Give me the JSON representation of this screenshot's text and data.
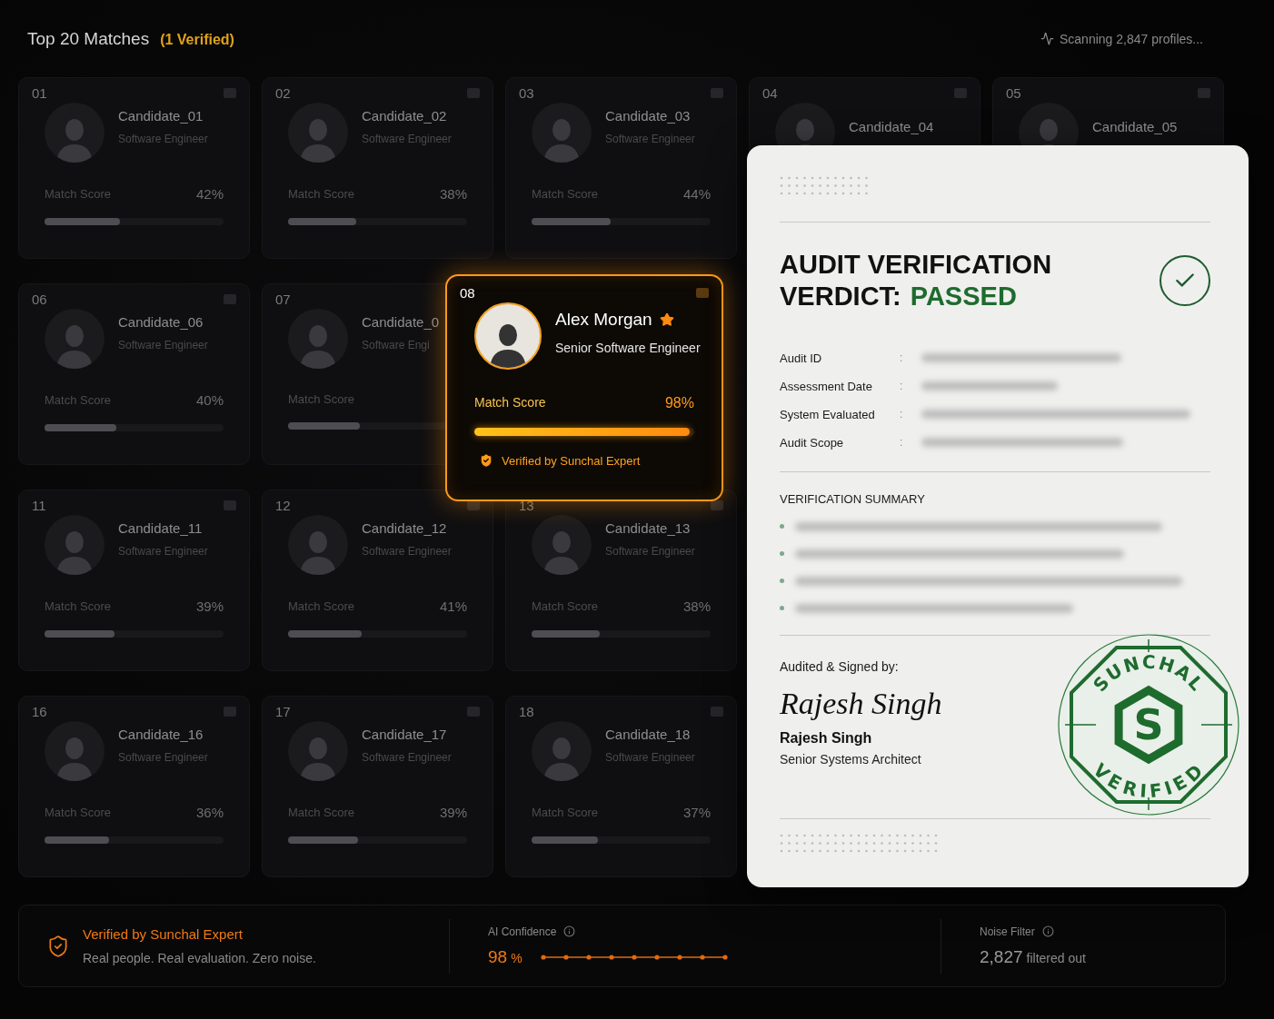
{
  "header": {
    "title": "Top 20 Matches",
    "verified_note": "(1 Verified)",
    "status": "Scanning 2,847 profiles..."
  },
  "card_rows": [
    [
      {
        "kind": "standard",
        "number": "01",
        "name": "Candidate_01",
        "role": "Software Engineer",
        "score_label": "Match Score",
        "score": "42%",
        "level": 0.42
      },
      {
        "kind": "standard",
        "number": "02",
        "name": "Candidate_02",
        "role": "Software Engineer",
        "score_label": "Match Score",
        "score": "38%",
        "level": 0.38
      },
      {
        "kind": "standard",
        "number": "03",
        "name": "Candidate_03",
        "role": "Software Engineer",
        "score_label": "Match Score",
        "score": "44%",
        "level": 0.44
      },
      {
        "kind": "partial",
        "number": "04",
        "name": "Candidate_04"
      },
      {
        "kind": "partial",
        "number": "05",
        "name": "Candidate_05"
      }
    ],
    [
      {
        "kind": "standard",
        "number": "06",
        "name": "Candidate_06",
        "role": "Software Engineer",
        "score_label": "Match Score",
        "score": "40%",
        "level": 0.4
      },
      {
        "kind": "standard",
        "number": "07",
        "name": "Candidate_0",
        "role": "Software Engi",
        "score_label": "Match Score",
        "level": 0.4
      },
      {
        "kind": "featured",
        "number": "08",
        "name": "Alex Morgan",
        "role": "Senior Software Engineer",
        "score_label": "Match Score",
        "score": "98%",
        "level": 0.98,
        "badge": "Verified by Sunchal Expert"
      }
    ],
    [
      {
        "kind": "standard",
        "number": "11",
        "name": "Candidate_11",
        "role": "Software Engineer",
        "score_label": "Match Score",
        "score": "39%",
        "level": 0.39
      },
      {
        "kind": "standard",
        "number": "12",
        "name": "Candidate_12",
        "role": "Software Engineer",
        "score_label": "Match Score",
        "score": "41%",
        "level": 0.41
      },
      {
        "kind": "standard",
        "number": "13",
        "name": "Candidate_13",
        "role": "Software Engineer",
        "score_label": "Match Score",
        "score": "38%",
        "level": 0.38
      }
    ],
    [
      {
        "kind": "standard",
        "number": "16",
        "name": "Candidate_16",
        "role": "Software Engineer",
        "score_label": "Match Score",
        "score": "36%",
        "level": 0.36
      },
      {
        "kind": "standard",
        "number": "17",
        "name": "Candidate_17",
        "role": "Software Engineer",
        "score_label": "Match Score",
        "score": "39%",
        "level": 0.39
      },
      {
        "kind": "standard",
        "number": "18",
        "name": "Candidate_18",
        "role": "Software Engineer",
        "score_label": "Match Score",
        "score": "37%",
        "level": 0.37
      }
    ]
  ],
  "audit": {
    "title_line_1": "AUDIT VERIFICATION",
    "title_line_2": "VERDICT:",
    "verdict": "PASSED",
    "fields": [
      {
        "label": "Audit ID",
        "separator": ":"
      },
      {
        "label": "Assessment Date",
        "separator": ":"
      },
      {
        "label": "System Evaluated",
        "separator": ":"
      },
      {
        "label": "Audit Scope",
        "separator": ":"
      }
    ],
    "summary_heading": "VERIFICATION SUMMARY",
    "signed_by_label": "Audited & Signed by:",
    "signature": "Rajesh Singh",
    "signer_name": "Rajesh Singh",
    "signer_title": "Senior Systems Architect",
    "stamp": {
      "top_text": "SUNCHAL",
      "bottom_text": "VERIFIED",
      "logo_letter": "S"
    }
  },
  "footer": {
    "badge_title": "Verified by Sunchal Expert",
    "badge_subtitle": "Real people. Real evaluation. Zero noise.",
    "confidence_label": "AI Confidence",
    "confidence_value": "98",
    "confidence_unit": "%",
    "noise_label": "Noise Filter",
    "noise_value": "2,827",
    "noise_unit": "filtered out"
  }
}
